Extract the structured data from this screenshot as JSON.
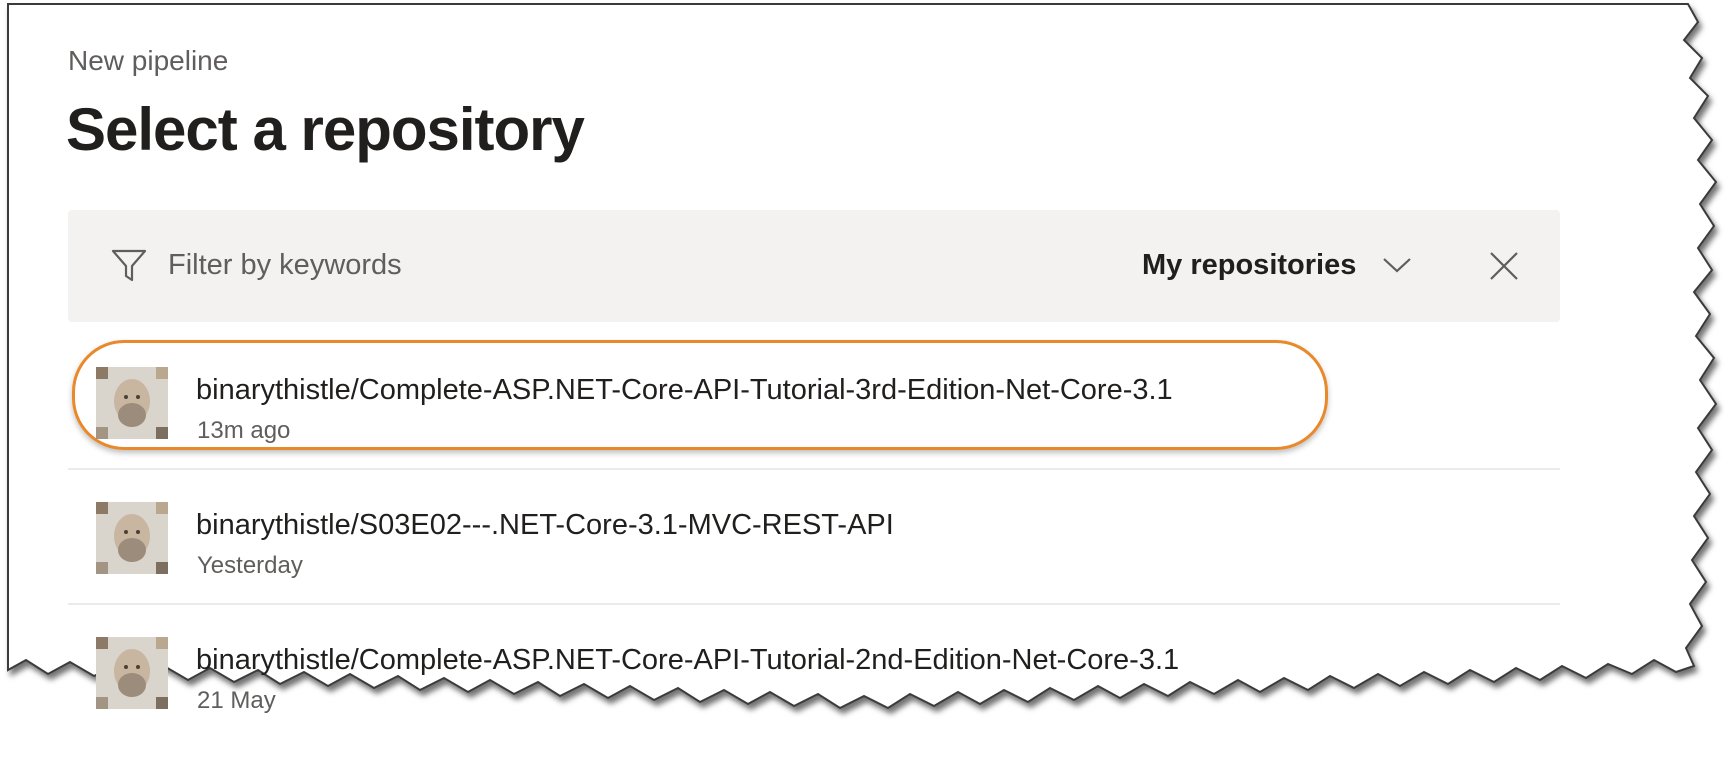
{
  "header": {
    "breadcrumb": "New pipeline",
    "title": "Select a repository"
  },
  "filter": {
    "placeholder": "Filter by keywords",
    "value": "",
    "scope_label": "My repositories"
  },
  "icons": {
    "filter": "filter-icon",
    "dropdown": "chevron-down-icon",
    "clear": "close-icon",
    "avatar": "user-avatar"
  },
  "colors": {
    "highlight": "#e8892c",
    "filter_bar_bg": "#f3f2f1",
    "primary_text": "#201f1e",
    "secondary_text": "#605e5c"
  },
  "repositories": [
    {
      "name": "binarythistle/Complete-ASP.NET-Core-API-Tutorial-3rd-Edition-Net-Core-3.1",
      "updated": "13m ago",
      "highlighted": true
    },
    {
      "name": "binarythistle/S03E02---.NET-Core-3.1-MVC-REST-API",
      "updated": "Yesterday",
      "highlighted": false
    },
    {
      "name": "binarythistle/Complete-ASP.NET-Core-API-Tutorial-2nd-Edition-Net-Core-3.1",
      "updated": "21 May",
      "highlighted": false
    }
  ]
}
